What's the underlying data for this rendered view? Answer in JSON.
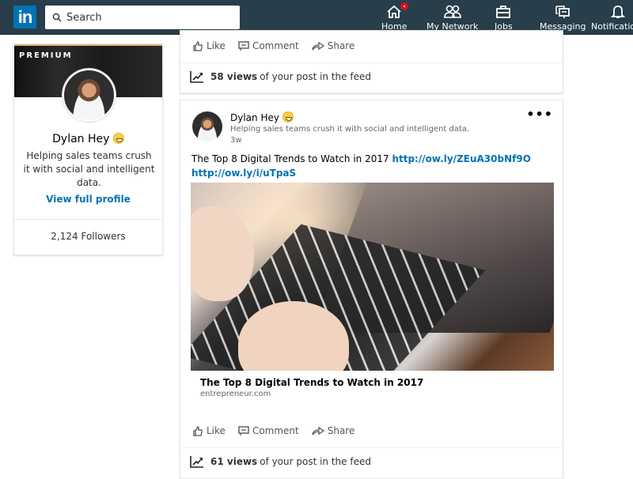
{
  "nav": {
    "logo": "in",
    "search_placeholder": "Search",
    "items": [
      {
        "label": "Home",
        "icon": "home-icon",
        "badge": true
      },
      {
        "label": "My Network",
        "icon": "network-icon"
      },
      {
        "label": "Jobs",
        "icon": "briefcase-icon"
      },
      {
        "label": "Messaging",
        "icon": "messaging-icon"
      },
      {
        "label": "Notifications",
        "icon": "bell-icon"
      }
    ]
  },
  "profile": {
    "badge": "PREMIUM",
    "name": "Dylan Hey",
    "headline": "Helping sales teams crush it with social and intelligent data.",
    "view_profile": "View full profile",
    "followers": "2,124 Followers"
  },
  "post1": {
    "actions": {
      "like": "Like",
      "comment": "Comment",
      "share": "Share"
    },
    "views_count": "58 views",
    "views_suffix": "of your post in the feed"
  },
  "post2": {
    "author": "Dylan Hey",
    "headline": "Helping sales teams crush it with social and intelligent data.",
    "time": "3w",
    "text": "The Top 8 Digital Trends to Watch in 2017",
    "link1": "http://ow.ly/ZEuA30bNf9O",
    "link2": "http://ow.ly/i/uTpaS",
    "article_title": "The Top 8 Digital Trends to Watch in 2017",
    "article_source": "entrepreneur.com",
    "actions": {
      "like": "Like",
      "comment": "Comment",
      "share": "Share"
    },
    "views_count": "61 views",
    "views_suffix": "of your post in the feed"
  }
}
